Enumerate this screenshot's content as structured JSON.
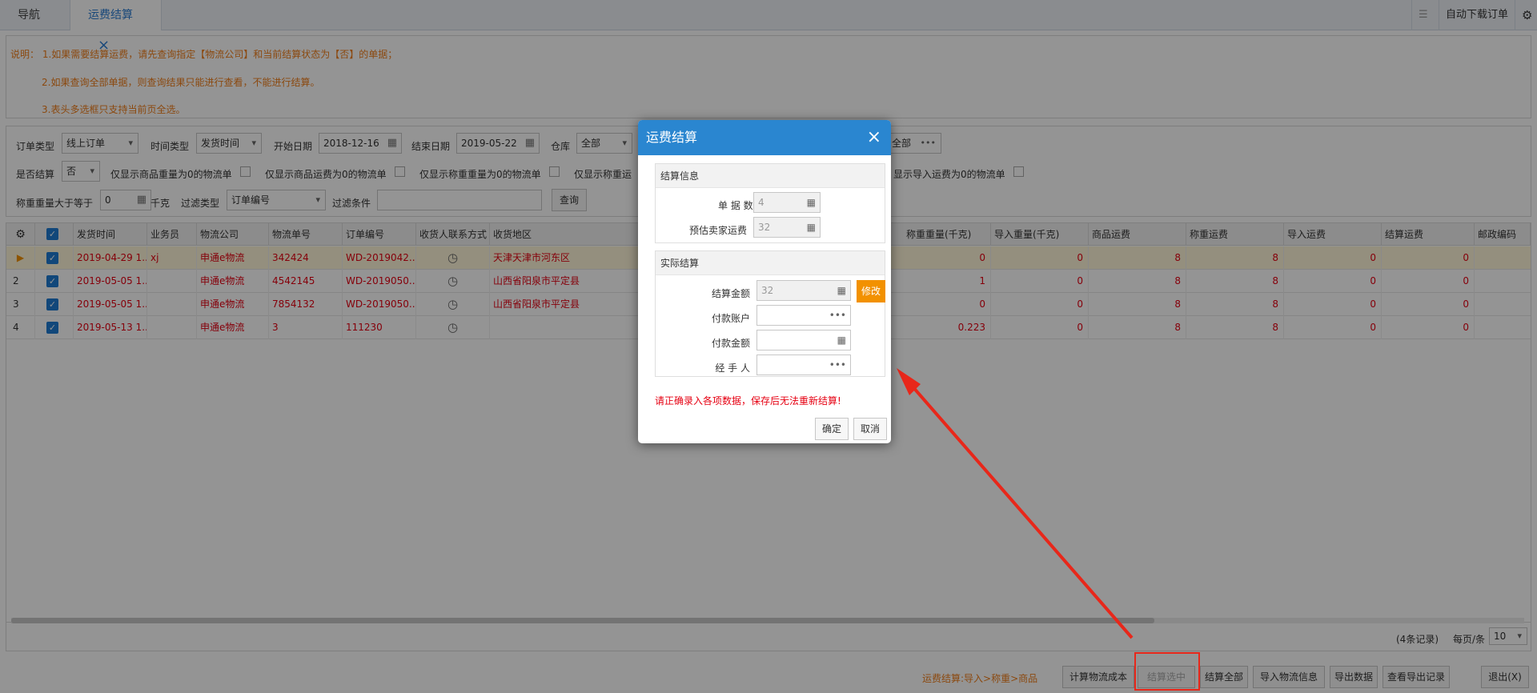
{
  "tabs": [
    {
      "label": "导航"
    },
    {
      "label": "运费结算",
      "close": "×"
    }
  ],
  "toolbar": {
    "auto_download": "自动下载订单"
  },
  "notice": [
    "说明：  1.如果需要结算运费，请先查询指定【物流公司】和当前结算状态为【否】的单据；",
    "2.如果查询全部单据，则查询结果只能进行查看，不能进行结算。",
    "3.表头多选框只支持当前页全选。"
  ],
  "filters": {
    "order_type_label": "订单类型",
    "order_type_value": "线上订单",
    "time_type_label": "时间类型",
    "time_type_value": "发货时间",
    "start_date_label": "开始日期",
    "start_date_value": "2018-12-16",
    "end_date_label": "结束日期",
    "end_date_value": "2019-05-22",
    "warehouse_label": "仓库",
    "warehouse_value": "全部",
    "logistics_value": "全部",
    "settled_label": "是否结算",
    "settled_value": "否",
    "cb_goods_weight_zero": "仅显示商品重量为0的物流单",
    "cb_goods_freight_zero": "仅显示商品运费为0的物流单",
    "cb_weighed_zero": "仅显示称重重量为0的物流单",
    "cb_weighed_freight_zero": "仅显示称重运",
    "cb_import_freight_zero": "显示导入运费为0的物流单",
    "weight_gt_label": "称重重量大于等于",
    "weight_gt_value": "0",
    "unit": "千克",
    "filter_type_label": "过滤类型",
    "filter_type_value": "订单编号",
    "filter_cond_label": "过滤条件",
    "filter_cond_value": "",
    "query_button": "查询"
  },
  "grid": {
    "columns": [
      "发货时间",
      "业务员",
      "物流公司",
      "物流单号",
      "订单编号",
      "收货人联系方式",
      "收货地区",
      "称重重量(千克)",
      "导入重量(千克)",
      "商品运费",
      "称重运费",
      "导入运费",
      "结算运费",
      "邮政编码"
    ],
    "rows": [
      {
        "num": "",
        "send_time": "2019-04-29 1...",
        "salesman": "xj",
        "company": "申通e物流",
        "waybill": "342424",
        "order_no": "WD-2019042...",
        "region": "天津天津市河东区",
        "weigh_w": "0",
        "import_w": "0",
        "goods_fee": "8",
        "weigh_fee": "8",
        "import_fee": "0",
        "settle_fee": "0"
      },
      {
        "num": "2",
        "send_time": "2019-05-05 1...",
        "salesman": "",
        "company": "申通e物流",
        "waybill": "4542145",
        "order_no": "WD-2019050...",
        "region": "山西省阳泉市平定县",
        "weigh_w": "1",
        "import_w": "0",
        "goods_fee": "8",
        "weigh_fee": "8",
        "import_fee": "0",
        "settle_fee": "0"
      },
      {
        "num": "3",
        "send_time": "2019-05-05 1...",
        "salesman": "",
        "company": "申通e物流",
        "waybill": "7854132",
        "order_no": "WD-2019050...",
        "region": "山西省阳泉市平定县",
        "weigh_w": "0",
        "import_w": "0",
        "goods_fee": "8",
        "weigh_fee": "8",
        "import_fee": "0",
        "settle_fee": "0"
      },
      {
        "num": "4",
        "send_time": "2019-05-13 1...",
        "salesman": "",
        "company": "申通e物流",
        "waybill": "3",
        "order_no": "111230",
        "region": "",
        "weigh_w": "0.223",
        "import_w": "0",
        "goods_fee": "8",
        "weigh_fee": "8",
        "import_fee": "0",
        "settle_fee": "0"
      }
    ]
  },
  "pager": {
    "records": "(4条记录)",
    "per_page_label": "每页/条",
    "per_page_value": "10"
  },
  "bottom": {
    "formula": "运费结算:导入>称重>商品",
    "calc_cost": "计算物流成本",
    "settle_selected": "结算选中",
    "settle_all": "结算全部",
    "import_info": "导入物流信息",
    "export_data": "导出数据",
    "view_export": "查看导出记录",
    "exit": "退出(X)"
  },
  "modal": {
    "title": "运费结算",
    "close": "×",
    "section1_title": "结算信息",
    "doc_count_label": "单 据 数",
    "doc_count_value": "4",
    "est_fee_label": "预估卖家运费",
    "est_fee_value": "32",
    "section2_title": "实际结算",
    "settle_amount_label": "结算金额",
    "settle_amount_value": "32",
    "modify_button": "修改",
    "pay_account_label": "付款账户",
    "pay_account_value": "",
    "pay_amount_label": "付款金额",
    "pay_amount_value": "",
    "handler_label": "经 手 人",
    "handler_value": "",
    "warning": "请正确录入各项数据，保存后无法重新结算!",
    "ok": "确定",
    "cancel": "取消"
  },
  "colors": {
    "accent": "#2a86d0",
    "warn": "#e60012",
    "orange": "#f29100",
    "notice": "#ef7e1b",
    "highlight": "#e8271a"
  }
}
